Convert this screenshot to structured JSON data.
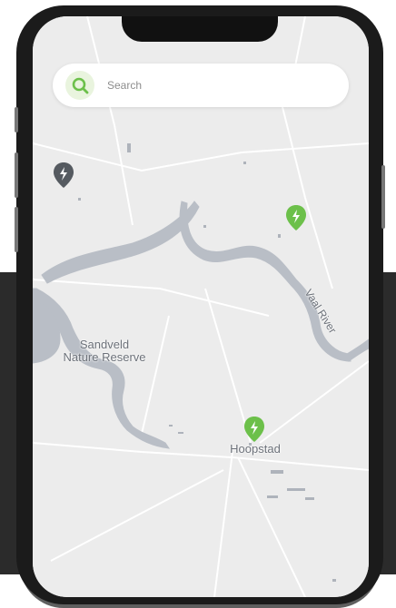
{
  "search": {
    "icon": "search-icon",
    "placeholder": "Search"
  },
  "map": {
    "labels": {
      "nature_reserve": "Sandveld\nNature Reserve",
      "town": "Hoopstad",
      "river": "Vaal River"
    },
    "pins": [
      {
        "icon": "charging-station-pin-icon",
        "color": "#555a60"
      },
      {
        "icon": "charging-station-pin-icon",
        "color": "#6cc04a"
      },
      {
        "icon": "charging-station-pin-icon",
        "color": "#6cc04a"
      }
    ]
  },
  "colors": {
    "accent_green": "#6cc04a",
    "water": "#b9bec6",
    "map_background": "#ececec",
    "background_dark": "#2b2b2b"
  }
}
